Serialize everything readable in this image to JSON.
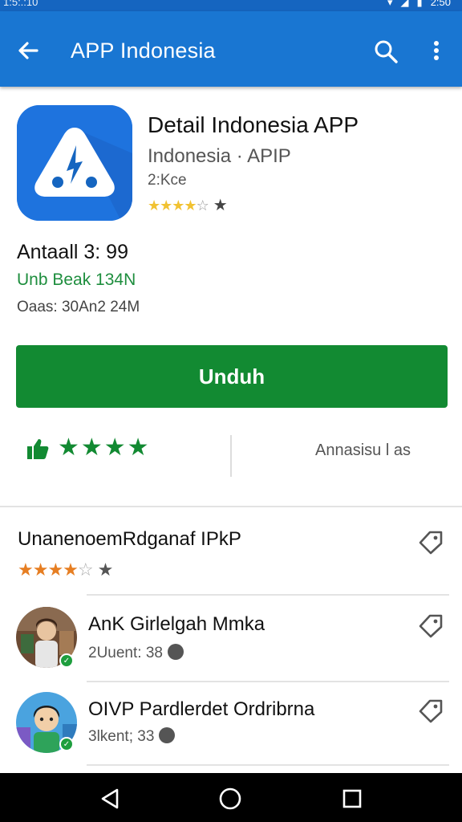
{
  "status_bar": {
    "time": "1:5:.:10",
    "clock_right": "2:50"
  },
  "app_bar": {
    "title": "APP Indonesia",
    "back_icon": "arrow-left-icon",
    "search_icon": "search-icon",
    "more_icon": "more-vert-icon",
    "color": "#1976d2"
  },
  "app": {
    "title": "Detail Indonesia APP",
    "developer": "Indonesia · APIP",
    "size": "2:Kce",
    "rating_stars": {
      "filled": "★★★",
      "half": "★",
      "empty": "☆",
      "extra": "★"
    },
    "icon_color": "#1e73de"
  },
  "info": {
    "line1": "Antaall 3: 99",
    "line2": "Unb Beak 134N",
    "line3": "Oaas: 30An2 24M"
  },
  "install_button": {
    "label": "Unduh",
    "color": "#128a32"
  },
  "rating": {
    "stars": "★★★★",
    "label": "Annasisu l as"
  },
  "review": {
    "title": "UnanenoemRdganaf IPkP",
    "stars_filled": "★★★★",
    "stars_empty": "☆",
    "star_extra": "★"
  },
  "reviewers": [
    {
      "name": "AnK Girlelgah Mmka",
      "meta": "2Uuent: 38"
    },
    {
      "name": "OIVP Pardlerdet Ordribrna",
      "meta": "3lkent; 33"
    }
  ],
  "nav": {
    "back": "back-icon",
    "home": "home-icon",
    "recent": "recent-apps-icon"
  }
}
